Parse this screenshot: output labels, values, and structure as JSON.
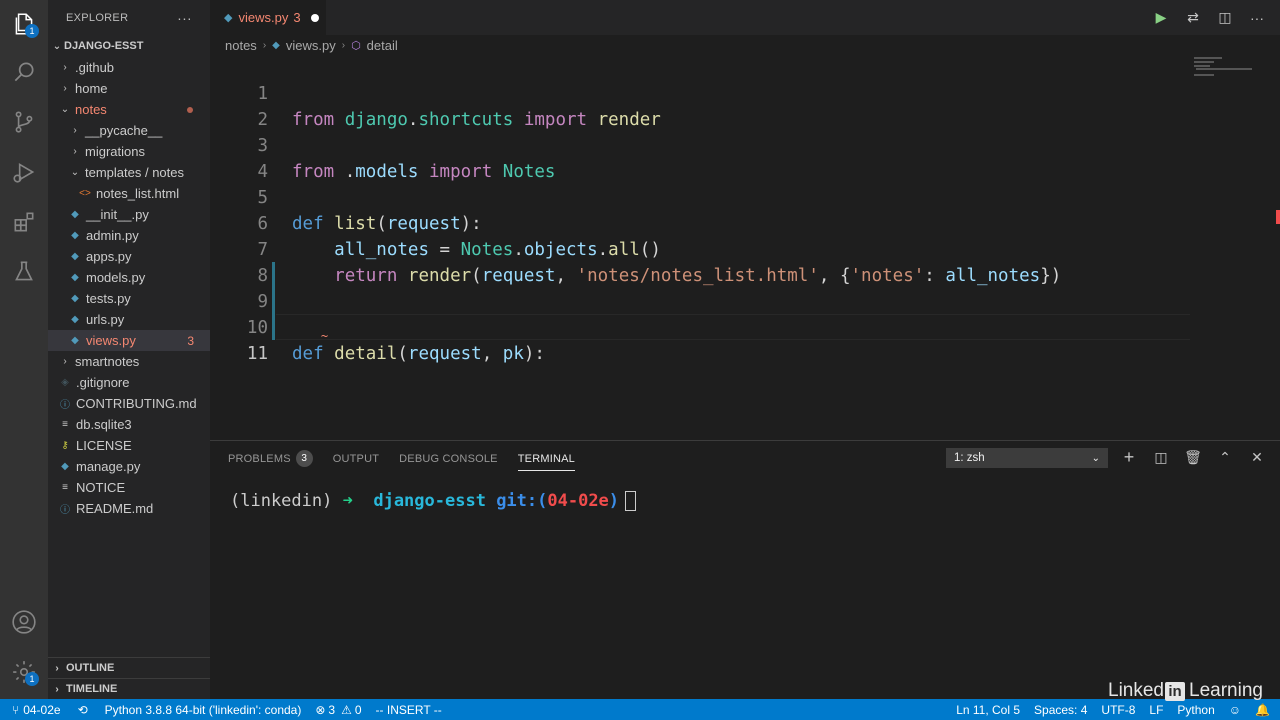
{
  "activity_bar": {
    "explorer_badge": "1",
    "settings_badge": "1"
  },
  "sidebar": {
    "title": "EXPLORER",
    "more": "···",
    "root": "DJANGO-ESST",
    "items": [
      {
        "label": ".github",
        "chev": "›",
        "indent": 0
      },
      {
        "label": "home",
        "chev": "›",
        "indent": 0
      },
      {
        "label": "notes",
        "chev": "⌄",
        "indent": 0
      },
      {
        "label": "__pycache__",
        "chev": "›",
        "indent": 1
      },
      {
        "label": "migrations",
        "chev": "›",
        "indent": 1
      },
      {
        "label": "templates / notes",
        "chev": "⌄",
        "indent": 1
      },
      {
        "label": "notes_list.html",
        "icon": "<>",
        "indent": 2
      },
      {
        "label": "__init__.py",
        "icon": "py",
        "indent": 1
      },
      {
        "label": "admin.py",
        "icon": "py",
        "indent": 1
      },
      {
        "label": "apps.py",
        "icon": "py",
        "indent": 1
      },
      {
        "label": "models.py",
        "icon": "py",
        "indent": 1
      },
      {
        "label": "tests.py",
        "icon": "py",
        "indent": 1
      },
      {
        "label": "urls.py",
        "icon": "py",
        "indent": 1
      },
      {
        "label": "views.py",
        "icon": "py",
        "indent": 1,
        "badge": "3"
      },
      {
        "label": "smartnotes",
        "chev": "›",
        "indent": 0
      },
      {
        "label": ".gitignore",
        "icon": "git",
        "indent": 0
      },
      {
        "label": "CONTRIBUTING.md",
        "icon": "md",
        "indent": 0
      },
      {
        "label": "db.sqlite3",
        "icon": "db",
        "indent": 0
      },
      {
        "label": "LICENSE",
        "icon": "key",
        "indent": 0
      },
      {
        "label": "manage.py",
        "icon": "py",
        "indent": 0
      },
      {
        "label": "NOTICE",
        "icon": "txt",
        "indent": 0
      },
      {
        "label": "README.md",
        "icon": "info",
        "indent": 0
      }
    ],
    "outline": "OUTLINE",
    "timeline": "TIMELINE"
  },
  "tab": {
    "label": "views.py",
    "count": "3"
  },
  "breadcrumb": {
    "folder": "notes",
    "file": "views.py",
    "symbol": "detail"
  },
  "code": {
    "line_numbers": [
      "1",
      "2",
      "3",
      "4",
      "5",
      "6",
      "7",
      "8",
      "9",
      "10",
      "11"
    ]
  },
  "panel": {
    "tabs": {
      "problems": "PROBLEMS",
      "problems_count": "3",
      "output": "OUTPUT",
      "debug": "DEBUG CONSOLE",
      "terminal": "TERMINAL"
    },
    "terminal_select": "1: zsh",
    "terminal": {
      "env": "(linkedin)",
      "arrow": "➜",
      "dir": "django-esst",
      "git_open": "git:(",
      "branch": "04-02e",
      "git_close": ")"
    }
  },
  "status": {
    "branch": "04-02e",
    "interpreter": "Python 3.8.8 64-bit ('linkedin': conda)",
    "errors": "3",
    "warnings": "0",
    "mode": "-- INSERT --",
    "position": "Ln 11, Col 5",
    "spaces": "Spaces: 4",
    "encoding": "UTF-8",
    "eol": "LF",
    "language": "Python"
  },
  "watermark": {
    "left": "Linked",
    "in": "in",
    "right": "Learning"
  },
  "colors": {
    "accent": "#007acc",
    "error": "#f48771"
  }
}
